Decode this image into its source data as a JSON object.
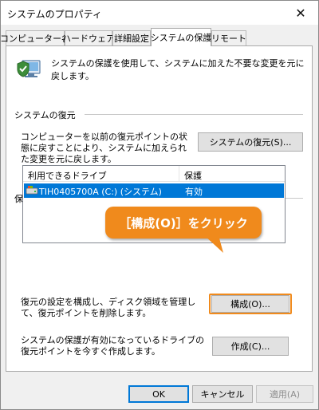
{
  "window": {
    "title": "システムのプロパティ",
    "close_glyph": "✕"
  },
  "tabs": [
    {
      "label": "コンピューター名",
      "active": false
    },
    {
      "label": "ハードウェア",
      "active": false
    },
    {
      "label": "詳細設定",
      "active": false
    },
    {
      "label": "システムの保護",
      "active": true
    },
    {
      "label": "リモート",
      "active": false
    }
  ],
  "intro": {
    "text": "システムの保護を使用して、システムに加えた不要な変更を元に戻します。",
    "icon": "system-protection-shield-icon"
  },
  "restore_section": {
    "label": "システムの復元",
    "description": "コンピューターを以前の復元ポイントの状態に戻すことにより、システムに加えられた変更を元に戻します。",
    "button_label": "システムの復元(S)..."
  },
  "protection_section": {
    "label": "保護設定",
    "columns": [
      "利用できるドライブ",
      "保護"
    ],
    "drives": [
      {
        "name": "TIH0405700A (C:) (システム)",
        "status": "有効",
        "icon": "drive-icon",
        "selected": true
      }
    ],
    "configure_description": "復元の設定を構成し、ディスク領域を管理して、復元ポイントを削除します。",
    "configure_button": "構成(O)...",
    "create_description": "システムの保護が有効になっているドライブの復元ポイントを今すぐ作成します。",
    "create_button": "作成(C)..."
  },
  "callout": {
    "text": "［構成(O)］をクリック",
    "color": "#f08a1c"
  },
  "footer": {
    "ok_label": "OK",
    "cancel_label": "キャンセル",
    "apply_label": "適用(A)"
  },
  "colors": {
    "selection": "#0078d7",
    "highlight": "#f08a1c"
  }
}
